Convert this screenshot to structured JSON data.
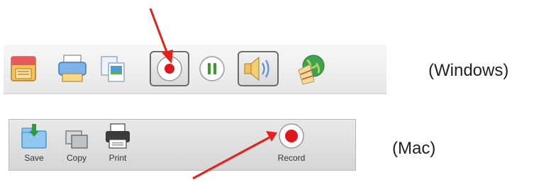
{
  "windows": {
    "label": "(Windows)",
    "icons": [
      "floppy-disk-icon",
      "printer-icon",
      "copy-icon",
      "record-icon",
      "pause-icon",
      "speaker-icon",
      "map-globe-icon"
    ]
  },
  "mac": {
    "label": "(Mac)",
    "buttons": {
      "save": "Save",
      "copy": "Copy",
      "print": "Print",
      "record": "Record"
    }
  },
  "colors": {
    "record_red": "#e0161e",
    "pause_green": "#3c9a2c",
    "arrow_red": "#e8201c"
  }
}
